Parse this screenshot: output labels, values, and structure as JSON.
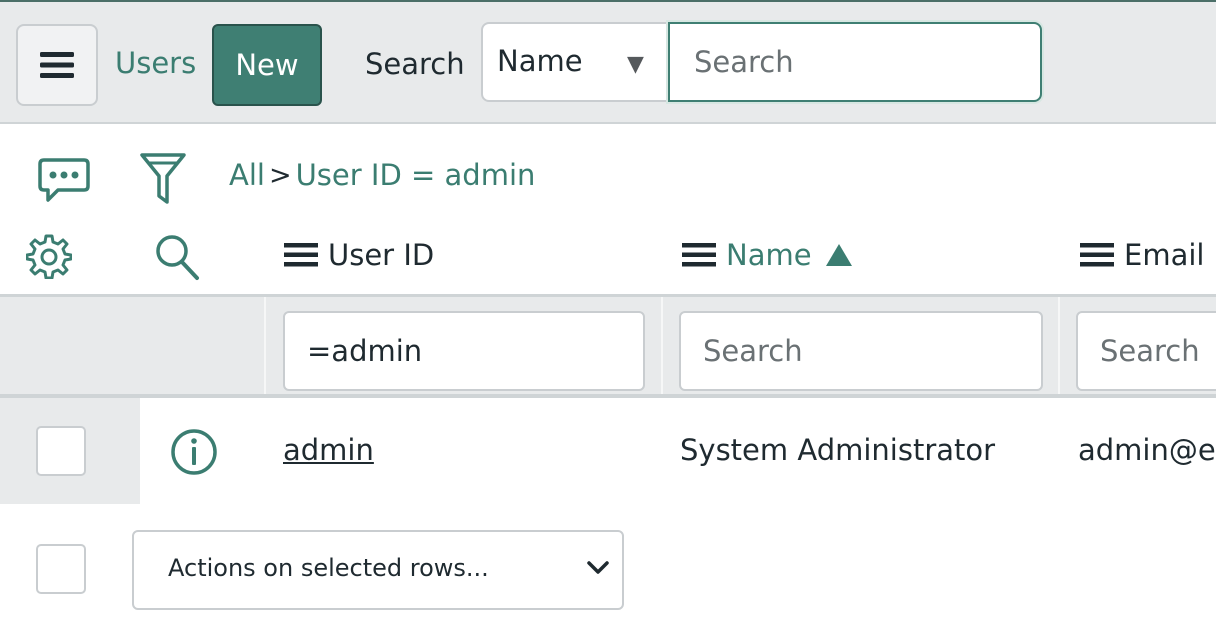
{
  "header": {
    "list_title": "Users",
    "new_label": "New",
    "search_label": "Search",
    "field_select_value": "Name",
    "search_placeholder": "Search"
  },
  "breadcrumb": {
    "all": "All",
    "separator": ">",
    "condition": "User ID = admin"
  },
  "columns": {
    "user_id": "User ID",
    "name": "Name",
    "email": "Email"
  },
  "filters": {
    "user_id_value": "=admin",
    "name_placeholder": "Search",
    "email_placeholder": "Search"
  },
  "rows": [
    {
      "user_id": "admin",
      "name": "System Administrator",
      "email": "admin@ex"
    }
  ],
  "footer": {
    "actions_label": "Actions on selected rows..."
  },
  "colors": {
    "accent": "#3f7f73",
    "link": "#3b7d71",
    "header_bg": "#e8eaeb"
  },
  "icons": {
    "menu": "hamburger-icon",
    "chat": "chat-bubble-icon",
    "filter": "funnel-icon",
    "settings": "gear-icon",
    "column_search": "magnifier-icon",
    "column_menu": "hamburger-icon",
    "sort": "triangle-up-icon",
    "info": "info-circle-icon",
    "chevron": "chevron-down-icon"
  }
}
